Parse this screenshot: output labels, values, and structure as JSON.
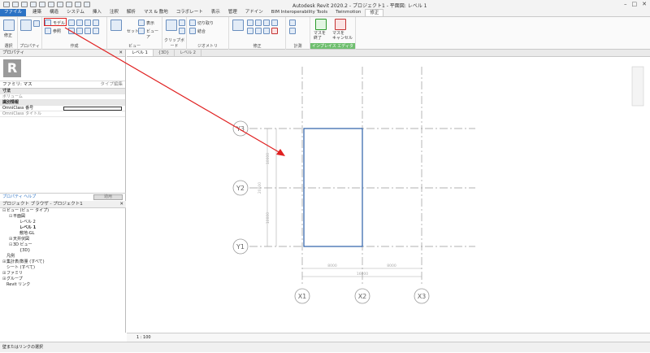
{
  "window": {
    "title": "Autodesk Revit 2020.2 - プロジェクト1 - 平面図: レベル 1"
  },
  "ribbon_tabs": [
    "ファイル",
    "建築",
    "構造",
    "システム",
    "挿入",
    "注釈",
    "解析",
    "マス & 敷地",
    "コラボレート",
    "表示",
    "管理",
    "アドイン",
    "BIM Interoperability Tools",
    "Twinmotion",
    "修正"
  ],
  "ribbon_groups": {
    "select": "選択",
    "properties": "プロパティ",
    "clipboard": "クリップボード",
    "geometry": "ジオメトリ",
    "modify": "修正",
    "measure": "計測",
    "create": "作成",
    "view": "ビュー",
    "inplace_editor": "インプレイス エディタ"
  },
  "ribbon_buttons": {
    "modify": "修正",
    "model_line": "モデル",
    "reference": "参照",
    "set": "セット",
    "show": "表示",
    "viewer": "ビューア",
    "finish_mass": "マスを\n終了",
    "cancel_mass": "マスを\nキャンセル",
    "cut": "切り取り",
    "join": "結合"
  },
  "properties": {
    "header": "プロパティ",
    "family_selector": "ファミリ: マス",
    "edit_type": "タイプ編集",
    "rows": [
      {
        "label": "寸法",
        "cat": true
      },
      {
        "label": "ボリューム",
        "cat": false,
        "gray": true
      },
      {
        "label": "識別情報",
        "cat": true
      },
      {
        "label": "OmniClass 番号",
        "cat": false,
        "box": true
      },
      {
        "label": "OmniClass タイトル",
        "cat": false,
        "gray": true
      }
    ],
    "help_link": "プロパティ ヘルプ",
    "apply": "適用"
  },
  "project_browser": {
    "header": "プロジェクト ブラウザ - プロジェクト1",
    "items": [
      {
        "label": "ビュー (ビュー タイプ)",
        "indent": 0,
        "toggle": "⊟"
      },
      {
        "label": "平面図",
        "indent": 1,
        "toggle": "⊟"
      },
      {
        "label": "レベル 2",
        "indent": 2,
        "toggle": ""
      },
      {
        "label": "レベル 1",
        "indent": 2,
        "toggle": "",
        "bold": true
      },
      {
        "label": "敷地-GL",
        "indent": 2,
        "toggle": ""
      },
      {
        "label": "天井伏図",
        "indent": 1,
        "toggle": "⊞"
      },
      {
        "label": "3D ビュー",
        "indent": 1,
        "toggle": "⊟"
      },
      {
        "label": "{3D}",
        "indent": 2,
        "toggle": ""
      },
      {
        "label": "凡例",
        "indent": 0,
        "toggle": ""
      },
      {
        "label": "集計表/数量 (すべて)",
        "indent": 0,
        "toggle": "⊞"
      },
      {
        "label": "シート (すべて)",
        "indent": 0,
        "toggle": ""
      },
      {
        "label": "ファミリ",
        "indent": 0,
        "toggle": "⊞"
      },
      {
        "label": "グループ",
        "indent": 0,
        "toggle": "⊞"
      },
      {
        "label": "Revit リンク",
        "indent": 0,
        "toggle": ""
      }
    ]
  },
  "view_tabs": [
    "レベル 1",
    "{3D}",
    "レベル 2"
  ],
  "grid_labels": {
    "y1": "Y1",
    "y2": "Y2",
    "y3": "Y3",
    "x1": "X1",
    "x2": "X2",
    "x3": "X3"
  },
  "dimensions": {
    "v_upper": "10000",
    "v_lower": "10000",
    "v_total": "20000",
    "h_left": "8000",
    "h_right": "8000",
    "h_total": "16000"
  },
  "view_control": {
    "scale": "1 : 100"
  },
  "status": "壁またはリンクの選択"
}
